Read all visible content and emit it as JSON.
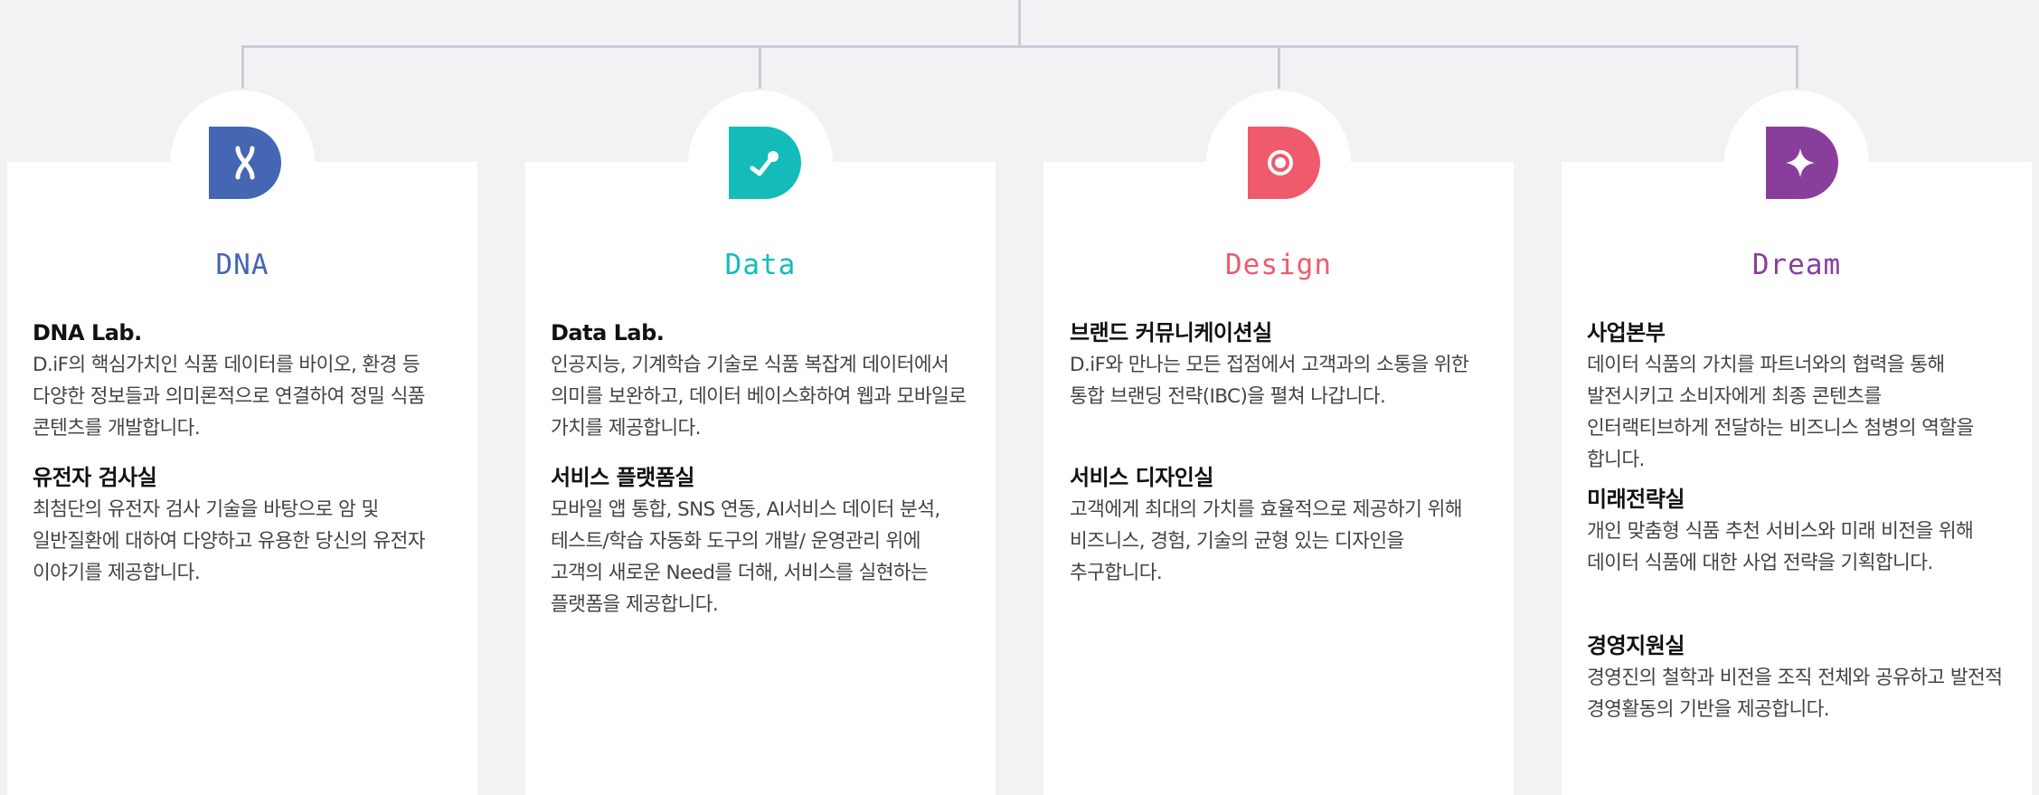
{
  "columns": [
    {
      "title": "DNA",
      "icon": "dna-icon",
      "color": "#4466b3",
      "sections": [
        {
          "heading": "DNA Lab.",
          "text": "D.iF의 핵심가치인 식품 데이터를 바이오, 환경 등 다양한 정보들과 의미론적으로 연결하여 정밀 식품 콘텐츠를 개발합니다."
        },
        {
          "heading": "유전자 검사실",
          "text": "최첨단의 유전자 검사 기술을 바탕으로 암 및 일반질환에 대하여 다양하고 유용한 당신의 유전자 이야기를 제공합니다."
        }
      ]
    },
    {
      "title": "Data",
      "icon": "data-graph-icon",
      "color": "#13bcba",
      "sections": [
        {
          "heading": "Data Lab.",
          "text": "인공지능, 기계학습 기술로 식품 복잡계 데이터에서 의미를 보완하고, 데이터 베이스화하여 웹과 모바일로 가치를 제공합니다."
        },
        {
          "heading": "서비스 플랫폼실",
          "text": "모바일 앱 통합, SNS 연동, AI서비스 데이터 분석, 테스트/학습 자동화 도구의 개발/ 운영관리 위에 고객의 새로운 Need를 더해, 서비스를 실현하는 플랫폼을 제공합니다."
        }
      ]
    },
    {
      "title": "Design",
      "icon": "design-circle-icon",
      "color": "#ef5b6c",
      "sections": [
        {
          "heading": "브랜드 커뮤니케이션실",
          "text": "D.iF와 만나는 모든 접점에서 고객과의 소통을 위한 통합 브랜딩 전략(IBC)을 펼쳐 나갑니다."
        },
        {
          "heading": "서비스 디자인실",
          "text": "고객에게 최대의 가치를 효율적으로 제공하기 위해 비즈니스, 경험, 기술의 균형 있는 디자인을 추구합니다."
        }
      ]
    },
    {
      "title": "Dream",
      "icon": "sparkle-star-icon",
      "color": "#8a3e9c",
      "sections": [
        {
          "heading": "사업본부",
          "text": "데이터 식품의 가치를 파트너와의 협력을 통해 발전시키고 소비자에게 최종 콘텐츠를 인터랙티브하게 전달하는 비즈니스 첨병의 역할을 합니다."
        },
        {
          "heading": "미래전략실",
          "text": "개인 맞춤형 식품 추천 서비스와 미래 비전을 위해 데이터 식품에 대한 사업 전략을 기획합니다."
        },
        {
          "heading": "경영지원실",
          "text": "경영진의 철학과 비전을 조직 전체와 공유하고 발전적 경영활동의 기반을 제공합니다."
        }
      ]
    }
  ]
}
